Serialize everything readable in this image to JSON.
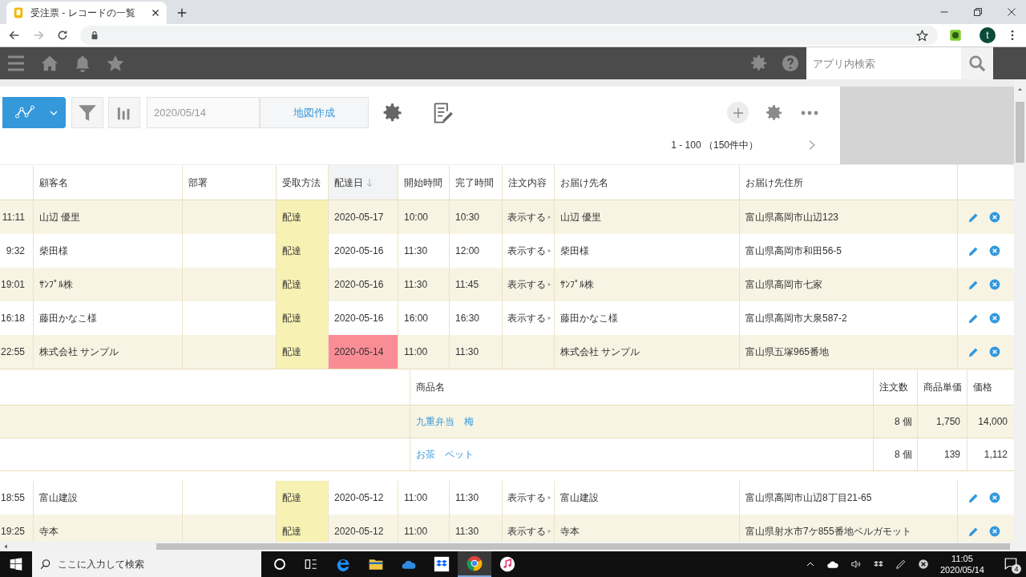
{
  "browser": {
    "tab_title": "受注票 - レコードの一覧",
    "profile_initial": "t"
  },
  "app_header": {
    "search_placeholder": "アプリ内検索"
  },
  "toolbar": {
    "date_value": "2020/05/14",
    "map_button": "地図作成"
  },
  "pagination": "1 - 100 （150件中）",
  "table": {
    "columns": [
      {
        "label": "顧客名",
        "sorted": false
      },
      {
        "label": "部署",
        "sorted": false
      },
      {
        "label": "受取方法",
        "sorted": false
      },
      {
        "label": "配達日",
        "sorted": true
      },
      {
        "label": "開始時間",
        "sorted": false
      },
      {
        "label": "完了時間",
        "sorted": false
      },
      {
        "label": "注文内容",
        "sorted": false
      },
      {
        "label": "お届け先名",
        "sorted": false
      },
      {
        "label": "お届け先住所",
        "sorted": false
      }
    ],
    "rows": [
      {
        "time": "11:11",
        "customer": "山辺 優里",
        "method": "配達",
        "date": "2020-05-17",
        "overdue": false,
        "start": "10:00",
        "end": "10:30",
        "order_link": "表示する",
        "recipient": "山辺 優里",
        "address": "富山県高岡市山辺123"
      },
      {
        "time": "9:32",
        "customer": "柴田様",
        "method": "配達",
        "date": "2020-05-16",
        "overdue": false,
        "start": "11:30",
        "end": "12:00",
        "order_link": "表示する",
        "recipient": "柴田様",
        "address": "富山県高岡市和田56-5"
      },
      {
        "time": "19:01",
        "customer": "ｻﾝﾌﾟﾙ株",
        "method": "配達",
        "date": "2020-05-16",
        "overdue": false,
        "start": "11:30",
        "end": "11:45",
        "order_link": "表示する",
        "recipient": "ｻﾝﾌﾟﾙ株",
        "address": "富山県高岡市七家"
      },
      {
        "time": "16:18",
        "customer": "藤田かなこ様",
        "method": "配達",
        "date": "2020-05-16",
        "overdue": false,
        "start": "16:00",
        "end": "16:30",
        "order_link": "表示する",
        "recipient": "藤田かなこ様",
        "address": "富山県高岡市大泉587-2"
      },
      {
        "time": "22:55",
        "customer": "株式会社 サンプル",
        "method": "配達",
        "date": "2020-05-14",
        "overdue": true,
        "start": "11:00",
        "end": "11:30",
        "recipient": "株式会社 サンプル",
        "address": "富山県五塚965番地",
        "details": {
          "columns": [
            "商品名",
            "注文数",
            "商品単価",
            "価格"
          ],
          "items": [
            {
              "name": "九重弁当　梅",
              "qty": "8 個",
              "unit_price": "1,750",
              "price": "14,000"
            },
            {
              "name": "お茶　ペット",
              "qty": "8 個",
              "unit_price": "139",
              "price": "1,112"
            }
          ]
        }
      },
      {
        "time": "18:55",
        "customer": "富山建設",
        "method": "配達",
        "date": "2020-05-12",
        "overdue": false,
        "start": "11:00",
        "end": "11:30",
        "order_link": "表示する",
        "recipient": "富山建設",
        "address": "富山県高岡市山辺8丁目21-65"
      },
      {
        "time": "19:25",
        "customer": "寺本",
        "method": "配達",
        "date": "2020-05-12",
        "overdue": false,
        "start": "11:00",
        "end": "11:30",
        "order_link": "表示する",
        "recipient": "寺本",
        "address": "富山県射水市7ケ855番地ベルガモット"
      }
    ]
  },
  "taskbar": {
    "search_placeholder": "ここに入力して検索",
    "time": "11:05",
    "date": "2020/05/14",
    "notification_count": "4"
  }
}
